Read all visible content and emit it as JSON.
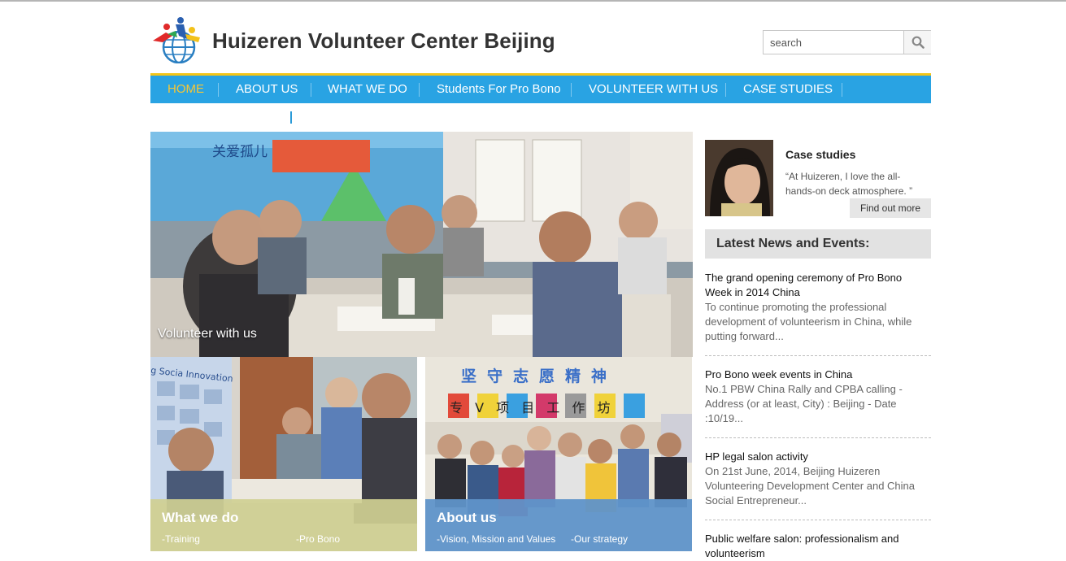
{
  "header": {
    "site_title": "Huizeren Volunteer Center Beijing",
    "search_placeholder": "search"
  },
  "nav": {
    "items": [
      {
        "label": "HOME",
        "active": true
      },
      {
        "label": "ABOUT US",
        "active": false
      },
      {
        "label": "WHAT WE DO",
        "active": false
      },
      {
        "label": "Students For Pro Bono",
        "active": false
      },
      {
        "label": "VOLUNTEER WITH US",
        "active": false
      },
      {
        "label": "CASE STUDIES",
        "active": false
      }
    ]
  },
  "hero": {
    "caption": "Volunteer with us",
    "banner_text": "关爱孤儿"
  },
  "tiles": {
    "what_we_do": {
      "title": "What we do",
      "links": [
        "-Training",
        "-Pro Bono"
      ],
      "wall_text": "g Socia Innovation"
    },
    "about_us": {
      "title": "About us",
      "links": [
        "-Vision, Mission and Values",
        "-Our strategy"
      ],
      "banner_top": "坚守志愿精神",
      "banner_bottom": "专 V 项 目 工 作 坊"
    }
  },
  "case_studies": {
    "title": "Case studies",
    "quote": "“At Huizeren, I love the all-hands-on deck atmosphere. ”",
    "button_label": "Find out more"
  },
  "news": {
    "header": "Latest News and Events:",
    "items": [
      {
        "title": "The grand opening ceremony of Pro Bono Week in 2014 China",
        "excerpt": "To continue promoting the professional development of volunteerism in China, while putting forward..."
      },
      {
        "title": "Pro Bono week events in China",
        "excerpt": "No.1 PBW China Rally and CPBA calling - Address (or at least, City) : Beijing - Date :10/19..."
      },
      {
        "title": "HP legal salon activity",
        "excerpt": "On 21st June, 2014, Beijing Huizeren Volunteering Development Center and China Social Entrepreneur..."
      },
      {
        "title": "Public welfare salon: professionalism and volunteerism",
        "excerpt": ""
      }
    ]
  },
  "colors": {
    "nav_bg": "#29a3e3",
    "nav_border": "#f4c518",
    "nav_active": "#f6c635",
    "tile_left_overlay": "#cfcf92",
    "tile_right_overlay": "#5f93c9"
  },
  "icons": {
    "search": "magnifier-icon",
    "logo": "globe-people-logo"
  }
}
